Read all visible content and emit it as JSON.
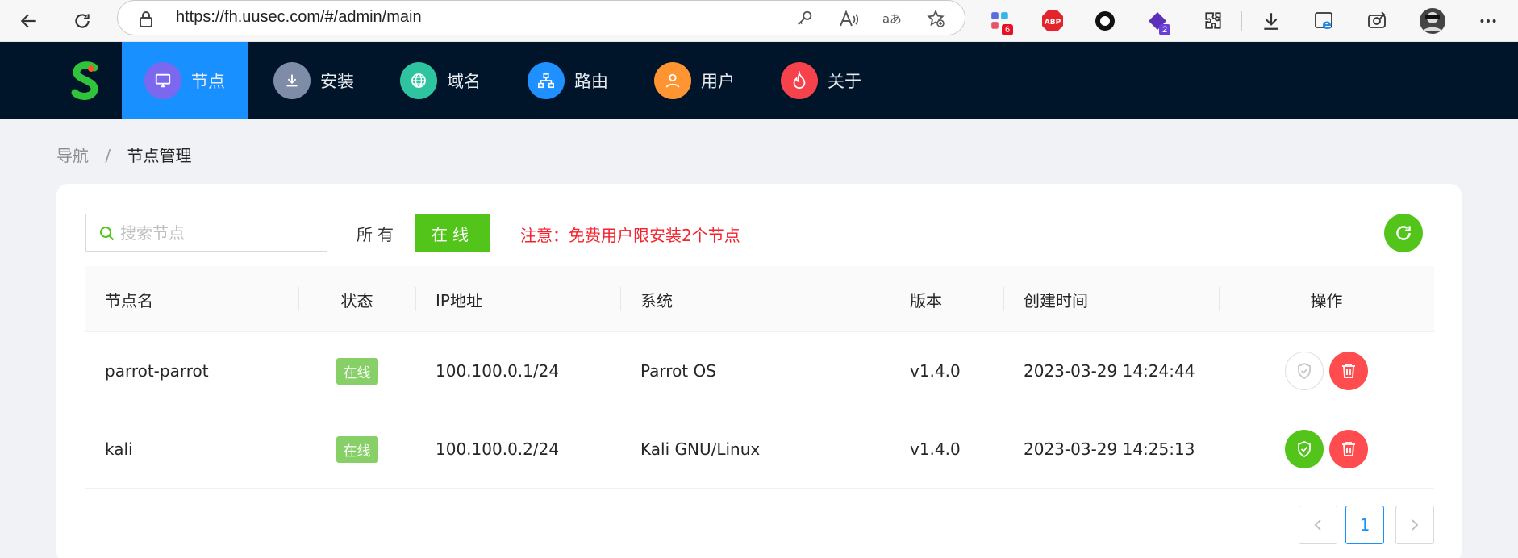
{
  "browser": {
    "url": "https://fh.uusec.com/#/admin/main",
    "extensions": [
      {
        "name": "apps-extension-icon",
        "badge": "6",
        "badge_color": "#e81123"
      },
      {
        "name": "adblock-plus-icon",
        "badge": ""
      },
      {
        "name": "circle-extension-icon",
        "badge": ""
      },
      {
        "name": "gem-extension-icon",
        "badge": "2",
        "badge_color": "#6a3fd9"
      }
    ]
  },
  "nav": {
    "items": [
      {
        "label": "节点",
        "icon": "monitor-icon",
        "color": "#7b68ee"
      },
      {
        "label": "安装",
        "icon": "download-icon",
        "color": "#7f8ca8"
      },
      {
        "label": "域名",
        "icon": "globe-icon",
        "color": "#2fc4a0"
      },
      {
        "label": "路由",
        "icon": "sitemap-icon",
        "color": "#1e90ff"
      },
      {
        "label": "用户",
        "icon": "user-icon",
        "color": "#ff9433"
      },
      {
        "label": "关于",
        "icon": "flame-icon",
        "color": "#f5424b"
      }
    ]
  },
  "breadcrumb": {
    "root": "导航",
    "separator": "/",
    "current": "节点管理"
  },
  "toolbar": {
    "search_placeholder": "搜索节点",
    "filter_all": "所有",
    "filter_online": "在线",
    "notice": "注意：免费用户限安装2个节点"
  },
  "table": {
    "headers": {
      "name": "节点名",
      "status": "状态",
      "ip": "IP地址",
      "os": "系统",
      "version": "版本",
      "created": "创建时间",
      "actions": "操作"
    },
    "rows": [
      {
        "name": "parrot-parrot",
        "status": "在线",
        "ip": "100.100.0.1/24",
        "os": "Parrot OS",
        "version": "v1.4.0",
        "created": "2023-03-29 14:24:44",
        "authorized": false
      },
      {
        "name": "kali",
        "status": "在线",
        "ip": "100.100.0.2/24",
        "os": "Kali GNU/Linux",
        "version": "v1.4.0",
        "created": "2023-03-29 14:25:13",
        "authorized": true
      }
    ]
  },
  "pagination": {
    "current": "1"
  },
  "colors": {
    "header_bg": "#001529",
    "active_nav": "#1890ff",
    "green": "#52c41a",
    "red": "#ff4d4f",
    "notice": "#f5222d"
  }
}
